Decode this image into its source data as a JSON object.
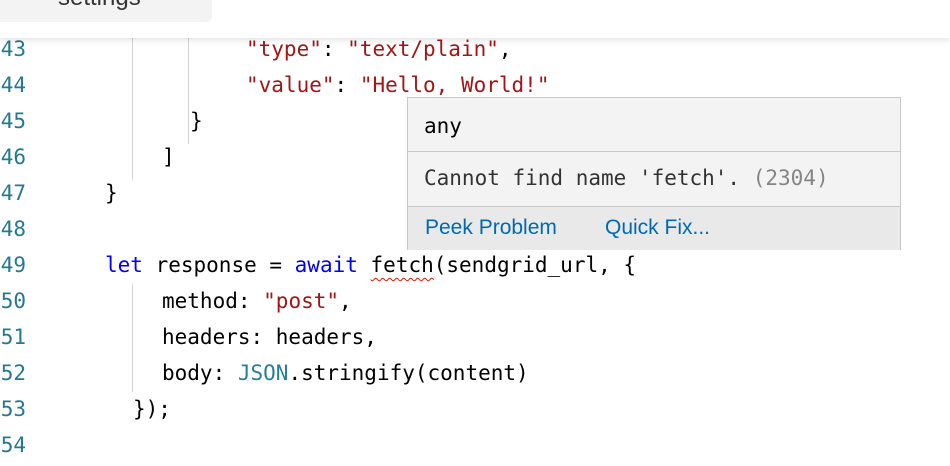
{
  "top_tab": {
    "label": "settings"
  },
  "editor": {
    "lines": [
      {
        "num": "43",
        "tokens": [
          {
            "t": "\"type\"",
            "c": "str"
          },
          {
            "t": ": "
          },
          {
            "t": "\"text/plain\"",
            "c": "str"
          },
          {
            "t": ","
          }
        ]
      },
      {
        "num": "44",
        "tokens": [
          {
            "t": "\"value\"",
            "c": "str"
          },
          {
            "t": ": "
          },
          {
            "t": "\"Hello, World!\"",
            "c": "str"
          }
        ]
      },
      {
        "num": "45",
        "tokens": [
          {
            "t": "}"
          }
        ]
      },
      {
        "num": "46",
        "tokens": [
          {
            "t": "]"
          }
        ]
      },
      {
        "num": "47",
        "tokens": [
          {
            "t": "}"
          }
        ]
      },
      {
        "num": "48",
        "tokens": []
      },
      {
        "num": "49",
        "tokens": [
          {
            "t": "let",
            "c": "kw"
          },
          {
            "t": " response = "
          },
          {
            "t": "await",
            "c": "kw"
          },
          {
            "t": " "
          },
          {
            "t": "fetch",
            "c": "err"
          },
          {
            "t": "(sendgrid_url, {"
          }
        ]
      },
      {
        "num": "50",
        "tokens": [
          {
            "t": "method: "
          },
          {
            "t": "\"post\"",
            "c": "str"
          },
          {
            "t": ","
          }
        ]
      },
      {
        "num": "51",
        "tokens": [
          {
            "t": "headers: headers,"
          }
        ]
      },
      {
        "num": "52",
        "tokens": [
          {
            "t": "body: "
          },
          {
            "t": "JSON",
            "c": "type"
          },
          {
            "t": ".stringify(content)"
          }
        ]
      },
      {
        "num": "53",
        "tokens": [
          {
            "t": "});"
          }
        ]
      },
      {
        "num": "54",
        "tokens": []
      }
    ]
  },
  "hover": {
    "type_text": "any",
    "message": "Cannot find name 'fetch'.",
    "error_code": "(2304)",
    "peek_problem_label": "Peek Problem",
    "quick_fix_label": "Quick Fix..."
  }
}
